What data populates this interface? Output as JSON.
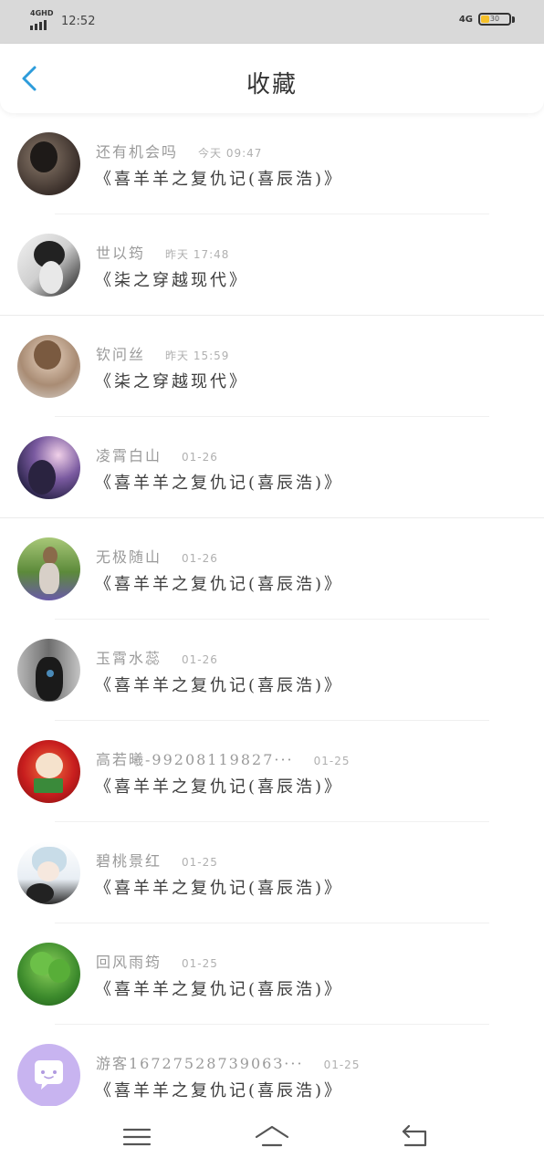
{
  "status_bar": {
    "network": "4GHD",
    "time": "12:52",
    "network_right": "4G",
    "battery_level": "30",
    "battery_fraction": 0.3,
    "battery_color": "#f5c02a",
    "icons": [
      "signal-icon",
      "battery-icon"
    ]
  },
  "header": {
    "title": "收藏",
    "back_icon": "back-arrow-icon",
    "accent_color": "#2d9cdb"
  },
  "favorites": [
    {
      "name": "还有机会吗",
      "time": "今天 09:47",
      "title": "《喜羊羊之复仇记(喜辰浩)》"
    },
    {
      "name": "世以筠",
      "time": "昨天 17:48",
      "title": "《柒之穿越现代》"
    },
    {
      "name": "钦问丝",
      "time": "昨天 15:59",
      "title": "《柒之穿越现代》"
    },
    {
      "name": "凌霄白山",
      "time": "01-26",
      "title": "《喜羊羊之复仇记(喜辰浩)》"
    },
    {
      "name": "无极随山",
      "time": "01-26",
      "title": "《喜羊羊之复仇记(喜辰浩)》"
    },
    {
      "name": "玉霄水蕊",
      "time": "01-26",
      "title": "《喜羊羊之复仇记(喜辰浩)》"
    },
    {
      "name": "高若曦-99208119827···",
      "time": "01-25",
      "title": "《喜羊羊之复仇记(喜辰浩)》"
    },
    {
      "name": "碧桃景红",
      "time": "01-25",
      "title": "《喜羊羊之复仇记(喜辰浩)》"
    },
    {
      "name": "回风雨筠",
      "time": "01-25",
      "title": "《喜羊羊之复仇记(喜辰浩)》"
    },
    {
      "name": "游客1672752873906З···",
      "time": "01-25",
      "title": "《喜羊羊之复仇记(喜辰浩)》"
    }
  ],
  "nav": {
    "icons": [
      "menu-icon",
      "home-icon",
      "back-icon"
    ]
  }
}
